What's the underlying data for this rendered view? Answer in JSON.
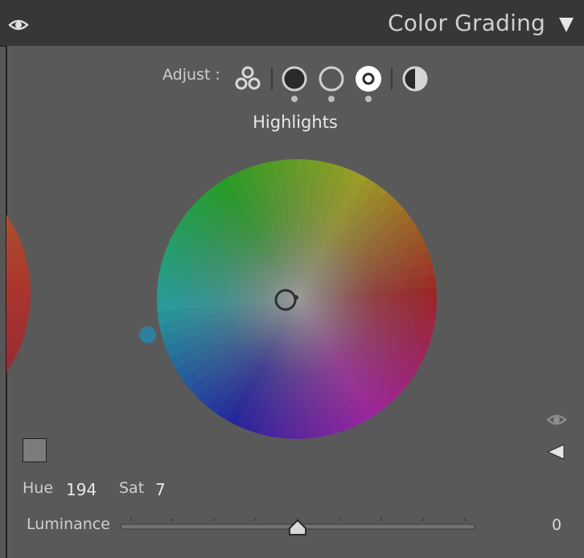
{
  "panel": {
    "title": "Color Grading",
    "header_eye_icon": "eye-icon",
    "collapse_icon": "triangle-down-icon"
  },
  "adjust": {
    "label": "Adjust :",
    "buttons": [
      {
        "name": "three-way",
        "icon": "three-circles-icon"
      },
      {
        "name": "shadows",
        "icon": "filled-circle-icon"
      },
      {
        "name": "midtones",
        "icon": "ring-circle-icon"
      },
      {
        "name": "highlights",
        "icon": "white-circle-icon",
        "selected": true
      },
      {
        "name": "global",
        "icon": "half-circle-icon"
      }
    ]
  },
  "wheel": {
    "title": "Highlights",
    "hue": 194,
    "sat": 7
  },
  "controls": {
    "hue_label": "Hue",
    "hue_value": "194",
    "sat_label": "Sat",
    "sat_value": "7",
    "luminance_label": "Luminance",
    "luminance_value": "0",
    "luminance_level": 0.5
  },
  "colors": {
    "panel_bg": "#595959",
    "header_bg": "#373737",
    "swatch": "#7c7c7c",
    "hue_marker": "#2f7f9e"
  }
}
